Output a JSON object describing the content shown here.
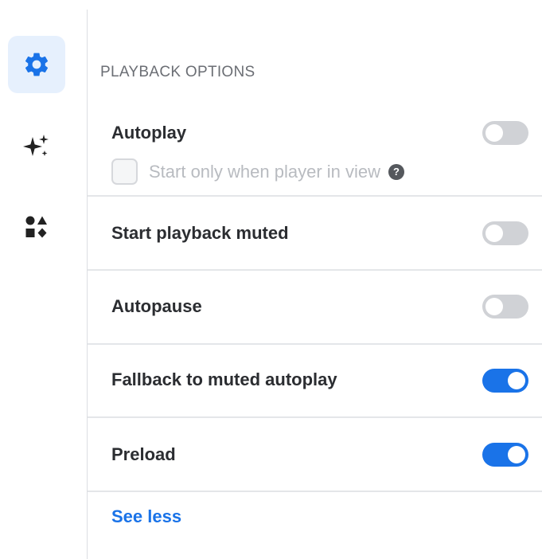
{
  "sidebar": {
    "items": [
      {
        "icon": "gear-icon",
        "active": true
      },
      {
        "icon": "sparkles-icon",
        "active": false
      },
      {
        "icon": "shapes-icon",
        "active": false
      }
    ]
  },
  "section": {
    "title": "PLAYBACK OPTIONS",
    "rows": [
      {
        "label": "Autoplay",
        "enabled": false,
        "sub_option": {
          "label": "Start only when player in view",
          "checked": false,
          "disabled": true,
          "help_glyph": "?"
        }
      },
      {
        "label": "Start playback muted",
        "enabled": false
      },
      {
        "label": "Autopause",
        "enabled": false
      },
      {
        "label": "Fallback to muted autoplay",
        "enabled": true
      },
      {
        "label": "Preload",
        "enabled": true
      }
    ],
    "see_less_label": "See less"
  },
  "colors": {
    "accent": "#1a73e8",
    "toggle_off": "#d0d2d6",
    "active_tab_bg": "#e6f0fd"
  }
}
